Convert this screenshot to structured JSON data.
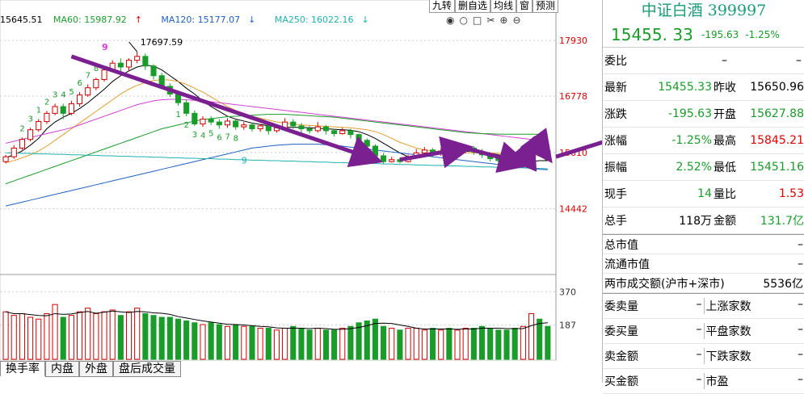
{
  "ma": {
    "ma5": "15645.51",
    "ma60": "MA60: 15987.92",
    "ma60_arrow": "↑",
    "ma120": "MA120: 15177.07",
    "ma120_arrow": "↓",
    "ma250": "MA250: 16022.16",
    "ma250_arrow": "↓"
  },
  "toolbar": [
    "九转",
    "删自选",
    "均线",
    "窗",
    "预测"
  ],
  "icons": [
    "eye-icon",
    "circle-icon",
    "square-icon",
    "cut-icon",
    "plus-circle-icon",
    "minus-circle-icon"
  ],
  "price_axis": [
    "17930",
    "16778",
    "15610",
    "14442"
  ],
  "volume_axis": [
    "370",
    "187"
  ],
  "annotations": {
    "high": "17697.59",
    "nine_a": "9",
    "nine_b": "9",
    "seq_up": [
      "2",
      "3",
      "1",
      "2",
      "3",
      "4",
      "5",
      "6",
      "7",
      "8"
    ],
    "seq_down": [
      "1",
      "2",
      "3",
      "4",
      "5",
      "6",
      "7",
      "8"
    ]
  },
  "bottom_tabs": [
    "换手率",
    "内盘",
    "外盘",
    "盘后成交量"
  ],
  "quote": {
    "title": "中证白酒 399997",
    "price": "15455. 33",
    "change": "-195.63",
    "pct": "-1.25%",
    "weibi_label": "委比",
    "weibi_v1": "–",
    "weibi_v2": "–",
    "rows": [
      {
        "l1": "最新",
        "v1": "15455.33",
        "c1": "grn",
        "l2": "昨收",
        "v2": "15650.96",
        "c2": ""
      },
      {
        "l1": "涨跌",
        "v1": "-195.63",
        "c1": "grn",
        "l2": "开盘",
        "v2": "15627.88",
        "c2": "grn"
      },
      {
        "l1": "涨幅",
        "v1": "-1.25%",
        "c1": "grn",
        "l2": "最高",
        "v2": "15845.21",
        "c2": "red"
      },
      {
        "l1": "振幅",
        "v1": "2.52%",
        "c1": "grn",
        "l2": "最低",
        "v2": "15451.16",
        "c2": "grn"
      },
      {
        "l1": "现手",
        "v1": "14",
        "c1": "grn",
        "l2": "量比",
        "v2": "1.53",
        "c2": "red"
      },
      {
        "l1": "总手",
        "v1": "118万",
        "c1": "",
        "l2": "金额",
        "v2": "131.7亿",
        "c2": "grn"
      }
    ],
    "mkt": [
      {
        "l": "总市值",
        "v": "–"
      },
      {
        "l": "流通市值",
        "v": "–"
      },
      {
        "l": "两市成交额(沪市+深市)",
        "v": "5536亿"
      }
    ],
    "split": [
      {
        "l1": "委卖量",
        "v1": "–",
        "l2": "上涨家数",
        "v2": "–"
      },
      {
        "l1": "委买量",
        "v1": "–",
        "l2": "平盘家数",
        "v2": "–"
      },
      {
        "l1": "卖金额",
        "v1": "–",
        "l2": "下跌家数",
        "v2": "–"
      },
      {
        "l1": "买金额",
        "v1": "–",
        "l2": "市盈",
        "v2": "–"
      }
    ]
  },
  "colors": {
    "up": "#d00000",
    "down": "#1a9c2a",
    "ma5": "#000000",
    "ma10": "#e0a030",
    "ma20": "#d040d0",
    "ma60": "#1a9c2a",
    "ma120": "#2060c0",
    "ma250": "#20b0b0",
    "arrow": "#7b2090"
  },
  "chart_data": {
    "type": "candlestick",
    "price_range": [
      14000,
      18200
    ],
    "volume_range": [
      0,
      420
    ],
    "candles": [
      [
        15420,
        15520,
        15380,
        15560
      ],
      [
        15520,
        15700,
        15480,
        15760
      ],
      [
        15700,
        15880,
        15660,
        15920
      ],
      [
        15880,
        16080,
        15840,
        16120
      ],
      [
        16080,
        16250,
        16040,
        16300
      ],
      [
        16250,
        16420,
        16200,
        16470
      ],
      [
        16420,
        16560,
        16380,
        16620
      ],
      [
        16560,
        16420,
        16300,
        16620
      ],
      [
        16420,
        16620,
        16380,
        16680
      ],
      [
        16620,
        16800,
        16560,
        16860
      ],
      [
        16800,
        16950,
        16760,
        17020
      ],
      [
        16950,
        17120,
        16900,
        17160
      ],
      [
        17120,
        17320,
        17080,
        17380
      ],
      [
        17320,
        17460,
        17280,
        17520
      ],
      [
        17460,
        17380,
        17260,
        17560
      ],
      [
        17380,
        17520,
        17300,
        17560
      ],
      [
        17520,
        17600,
        17460,
        17697
      ],
      [
        17600,
        17400,
        17320,
        17660
      ],
      [
        17400,
        17200,
        17120,
        17440
      ],
      [
        17200,
        16980,
        16920,
        17260
      ],
      [
        16980,
        16820,
        16760,
        17040
      ],
      [
        16820,
        16640,
        16580,
        16880
      ],
      [
        16640,
        16420,
        16360,
        16700
      ],
      [
        16420,
        16200,
        16160,
        16480
      ],
      [
        16200,
        16300,
        16140,
        16360
      ],
      [
        16300,
        16240,
        16180,
        16360
      ],
      [
        16240,
        16180,
        16100,
        16300
      ],
      [
        16180,
        16260,
        16120,
        16320
      ],
      [
        16260,
        16140,
        16080,
        16300
      ],
      [
        16140,
        16180,
        16080,
        16240
      ],
      [
        16180,
        16100,
        16040,
        16220
      ],
      [
        16100,
        16160,
        16040,
        16200
      ],
      [
        16160,
        16060,
        15980,
        16200
      ],
      [
        16060,
        16120,
        16020,
        16180
      ],
      [
        16120,
        16240,
        16080,
        16320
      ],
      [
        16240,
        16160,
        16100,
        16300
      ],
      [
        16160,
        16100,
        16020,
        16220
      ],
      [
        16100,
        16060,
        16000,
        16160
      ],
      [
        16060,
        16140,
        16020,
        16240
      ],
      [
        16140,
        16060,
        15980,
        16180
      ],
      [
        16060,
        16000,
        15940,
        16100
      ],
      [
        16000,
        16060,
        15980,
        16120
      ],
      [
        16060,
        15980,
        15900,
        16100
      ],
      [
        15980,
        15860,
        15780,
        16000
      ],
      [
        15860,
        15740,
        15680,
        15900
      ],
      [
        15740,
        15540,
        15460,
        15780
      ],
      [
        15540,
        15420,
        15380,
        15600
      ],
      [
        15420,
        15460,
        15400,
        15520
      ],
      [
        15460,
        15420,
        15380,
        15500
      ],
      [
        15420,
        15520,
        15400,
        15560
      ],
      [
        15520,
        15600,
        15480,
        15680
      ],
      [
        15600,
        15660,
        15560,
        15720
      ],
      [
        15660,
        15580,
        15520,
        15700
      ],
      [
        15580,
        15640,
        15540,
        15700
      ],
      [
        15640,
        15600,
        15540,
        15680
      ],
      [
        15600,
        15660,
        15560,
        15720
      ],
      [
        15660,
        15700,
        15600,
        15780
      ],
      [
        15700,
        15620,
        15560,
        15740
      ],
      [
        15620,
        15560,
        15500,
        15680
      ],
      [
        15560,
        15480,
        15420,
        15600
      ],
      [
        15480,
        15440,
        15380,
        15520
      ],
      [
        15440,
        15380,
        15300,
        15480
      ],
      [
        15380,
        15340,
        15280,
        15440
      ],
      [
        15340,
        15400,
        15300,
        15460
      ],
      [
        15400,
        15700,
        15380,
        15780
      ],
      [
        15700,
        15650,
        15600,
        15780
      ],
      [
        15650,
        15455,
        15451,
        15845
      ]
    ],
    "volumes": [
      260,
      240,
      250,
      230,
      220,
      250,
      300,
      230,
      240,
      260,
      280,
      250,
      260,
      270,
      240,
      260,
      280,
      250,
      240,
      230,
      230,
      220,
      210,
      200,
      190,
      200,
      190,
      180,
      190,
      180,
      180,
      170,
      170,
      160,
      170,
      180,
      170,
      160,
      170,
      160,
      160,
      170,
      180,
      200,
      210,
      220,
      180,
      170,
      160,
      170,
      170,
      160,
      170,
      160,
      170,
      160,
      170,
      170,
      180,
      170,
      160,
      160,
      170,
      180,
      250,
      220,
      180
    ],
    "ma": {
      "ma5": [
        15500,
        15560,
        15640,
        15760,
        15900,
        16100,
        16240,
        16340,
        16420,
        16520,
        16640,
        16780,
        16920,
        17080,
        17200,
        17300,
        17380,
        17420,
        17400,
        17320,
        17200,
        17080,
        16940,
        16820,
        16680,
        16560,
        16460,
        16360,
        16300,
        16260,
        16220,
        16190,
        16160,
        16140,
        16130,
        16130,
        16130,
        16120,
        16110,
        16100,
        16090,
        16080,
        16070,
        16040,
        15980,
        15900,
        15800,
        15700,
        15600,
        15520,
        15500,
        15520,
        15560,
        15590,
        15610,
        15620,
        15630,
        15640,
        15620,
        15600,
        15560,
        15520,
        15480,
        15440,
        15420,
        15440,
        15440
      ],
      "ma10": [
        15400,
        15440,
        15500,
        15560,
        15640,
        15740,
        15860,
        15980,
        16100,
        16220,
        16340,
        16460,
        16580,
        16700,
        16820,
        16920,
        17000,
        17060,
        17100,
        17120,
        17110,
        17080,
        17020,
        16940,
        16860,
        16760,
        16660,
        16560,
        16480,
        16420,
        16360,
        16320,
        16280,
        16240,
        16220,
        16200,
        16180,
        16170,
        16160,
        16150,
        16140,
        16130,
        16120,
        16100,
        16080,
        16040,
        15980,
        15900,
        15820,
        15760,
        15700,
        15660,
        15640,
        15630,
        15620,
        15610,
        15600,
        15600,
        15600,
        15600,
        15590,
        15580,
        15570,
        15550,
        15540,
        15540,
        15540
      ],
      "ma20": [
        15800,
        15840,
        15880,
        15920,
        15960,
        16000,
        16040,
        16080,
        16120,
        16180,
        16240,
        16300,
        16360,
        16420,
        16480,
        16540,
        16600,
        16640,
        16680,
        16700,
        16710,
        16710,
        16700,
        16690,
        16680,
        16660,
        16640,
        16620,
        16600,
        16580,
        16560,
        16540,
        16520,
        16500,
        16480,
        16460,
        16440,
        16420,
        16400,
        16380,
        16360,
        16340,
        16320,
        16300,
        16280,
        16260,
        16240,
        16220,
        16200,
        16180,
        16160,
        16140,
        16120,
        16100,
        16080,
        16060,
        16040,
        16020,
        16000,
        15980,
        15960,
        15940,
        15920,
        15900,
        15880,
        15860,
        15840
      ],
      "ma60": [
        14960,
        15020,
        15080,
        15140,
        15200,
        15260,
        15320,
        15380,
        15440,
        15500,
        15560,
        15620,
        15680,
        15740,
        15800,
        15860,
        15920,
        15980,
        16040,
        16100,
        16140,
        16180,
        16220,
        16260,
        16290,
        16310,
        16330,
        16350,
        16360,
        16370,
        16380,
        16390,
        16400,
        16400,
        16400,
        16390,
        16380,
        16370,
        16360,
        16350,
        16340,
        16320,
        16300,
        16280,
        16260,
        16240,
        16220,
        16200,
        16180,
        16160,
        16140,
        16120,
        16100,
        16080,
        16060,
        16040,
        16020,
        16010,
        16000,
        15995,
        15990,
        15988,
        15987,
        15987,
        15988,
        15988,
        15988
      ],
      "ma120": [
        14500,
        14540,
        14580,
        14620,
        14660,
        14700,
        14740,
        14780,
        14820,
        14860,
        14900,
        14940,
        14980,
        15020,
        15060,
        15100,
        15140,
        15180,
        15220,
        15260,
        15300,
        15340,
        15380,
        15420,
        15460,
        15500,
        15540,
        15580,
        15620,
        15660,
        15700,
        15720,
        15740,
        15760,
        15770,
        15780,
        15780,
        15780,
        15780,
        15770,
        15760,
        15740,
        15720,
        15700,
        15680,
        15660,
        15640,
        15620,
        15600,
        15580,
        15560,
        15540,
        15520,
        15500,
        15480,
        15460,
        15440,
        15420,
        15400,
        15380,
        15360,
        15340,
        15320,
        15300,
        15280,
        15260,
        15250
      ],
      "ma250": [
        15600,
        15600,
        15590,
        15590,
        15580,
        15580,
        15570,
        15570,
        15560,
        15560,
        15550,
        15550,
        15540,
        15540,
        15530,
        15530,
        15520,
        15520,
        15510,
        15510,
        15500,
        15500,
        15490,
        15490,
        15480,
        15480,
        15470,
        15470,
        15460,
        15460,
        15450,
        15450,
        15440,
        15440,
        15430,
        15430,
        15420,
        15420,
        15410,
        15410,
        15400,
        15400,
        15390,
        15390,
        15380,
        15380,
        15370,
        15370,
        15360,
        15360,
        15350,
        15350,
        15340,
        15340,
        15330,
        15330,
        15320,
        15320,
        15310,
        15310,
        15300,
        15300,
        15290,
        15290,
        15280,
        15280,
        15270
      ]
    },
    "arrows": [
      {
        "from": [
          8,
          17600
        ],
        "to": [
          45,
          15460
        ]
      },
      {
        "from": [
          48,
          15460
        ],
        "to": [
          56,
          15700
        ]
      },
      {
        "from": [
          56,
          15700
        ],
        "to": [
          63,
          15380
        ]
      },
      {
        "from": [
          63,
          15400
        ],
        "to": [
          64,
          15800
        ]
      },
      {
        "from": [
          65,
          15750
        ],
        "to": [
          66,
          15520
        ]
      },
      {
        "from": [
          67,
          15520
        ],
        "to": [
          84,
          16420
        ]
      }
    ]
  }
}
